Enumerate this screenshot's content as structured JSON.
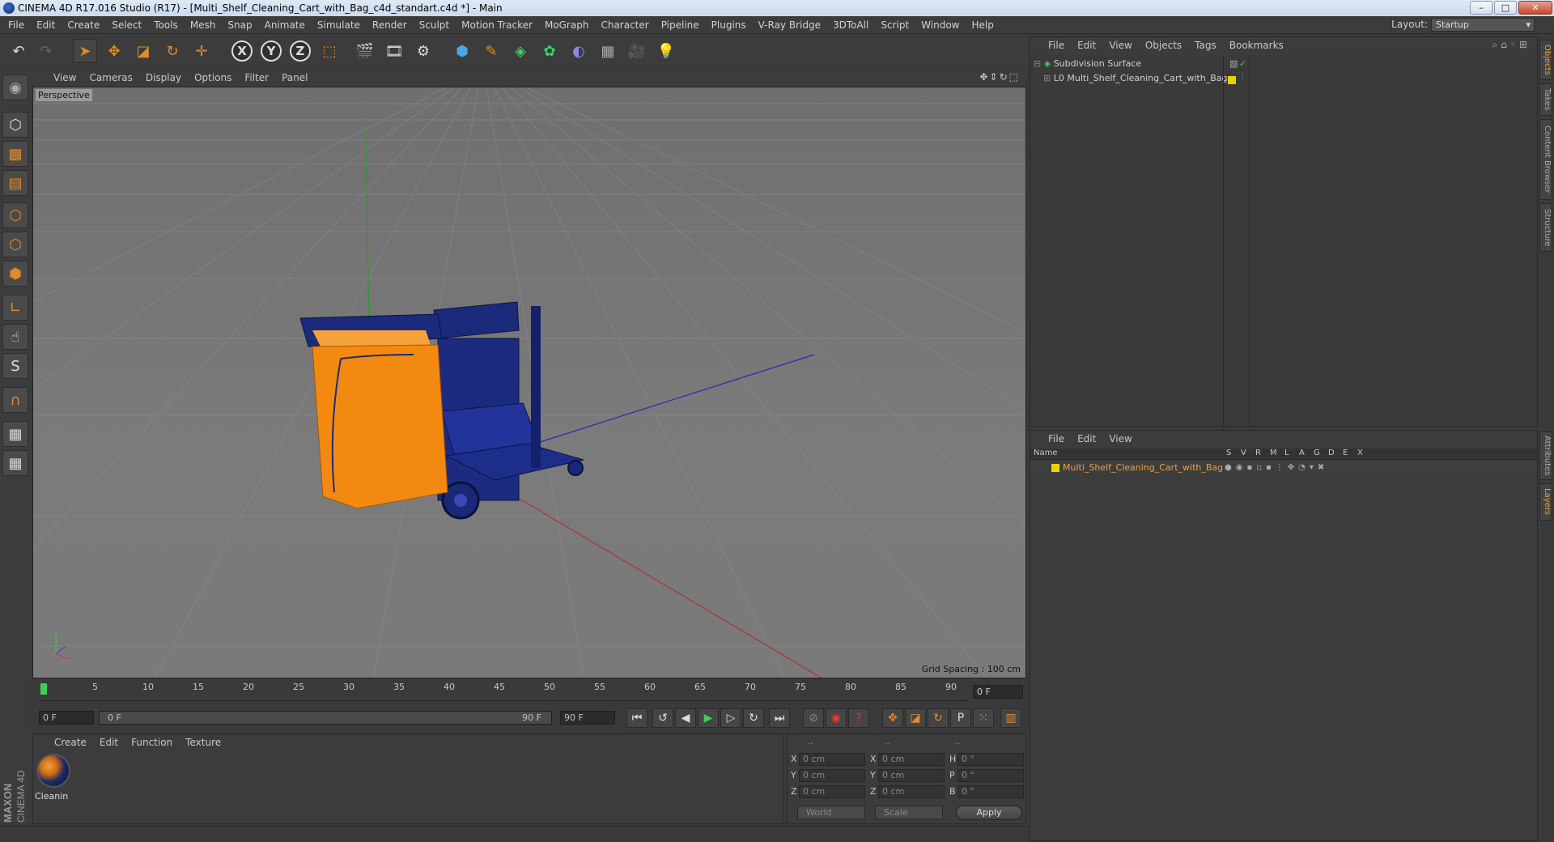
{
  "window": {
    "title": "CINEMA 4D R17.016 Studio (R17) - [Multi_Shelf_Cleaning_Cart_with_Bag_c4d_standart.c4d *] - Main",
    "minimize": "–",
    "maximize": "□",
    "close": "✕"
  },
  "menu": [
    "File",
    "Edit",
    "Create",
    "Select",
    "Tools",
    "Mesh",
    "Snap",
    "Animate",
    "Simulate",
    "Render",
    "Sculpt",
    "Motion Tracker",
    "MoGraph",
    "Character",
    "Pipeline",
    "Plugins",
    "V-Ray Bridge",
    "3DToAll",
    "Script",
    "Window",
    "Help"
  ],
  "layout": {
    "label": "Layout:",
    "value": "Startup"
  },
  "viewport": {
    "menu": [
      "View",
      "Cameras",
      "Display",
      "Options",
      "Filter",
      "Panel"
    ],
    "label": "Perspective",
    "grid_spacing": "Grid Spacing : 100 cm"
  },
  "timeline": {
    "ticks": [
      "0",
      "5",
      "10",
      "15",
      "20",
      "25",
      "30",
      "35",
      "40",
      "45",
      "50",
      "55",
      "60",
      "65",
      "70",
      "75",
      "80",
      "85",
      "90"
    ],
    "current_frame": "0 F",
    "start_frame": "0 F",
    "range_start": "0 F",
    "range_end": "90 F",
    "end_frame": "90 F"
  },
  "material_panel": {
    "menu": [
      "Create",
      "Edit",
      "Function",
      "Texture"
    ],
    "material_name": "Cleanin"
  },
  "coords": {
    "headers": [
      "--",
      "--",
      "--"
    ],
    "rows": [
      {
        "l1": "X",
        "v1": "0 cm",
        "l2": "X",
        "v2": "0 cm",
        "l3": "H",
        "v3": "0 °"
      },
      {
        "l1": "Y",
        "v1": "0 cm",
        "l2": "Y",
        "v2": "0 cm",
        "l3": "P",
        "v3": "0 °"
      },
      {
        "l1": "Z",
        "v1": "0 cm",
        "l2": "Z",
        "v2": "0 cm",
        "l3": "B",
        "v3": "0 °"
      }
    ],
    "mode": "World",
    "scale": "Scale",
    "apply": "Apply"
  },
  "maxon": {
    "brand": "MAXON",
    "product": "CINEMA 4D"
  },
  "objects_panel": {
    "menu": [
      "File",
      "Edit",
      "View",
      "Objects",
      "Tags",
      "Bookmarks"
    ],
    "items": [
      {
        "name": "Subdivision Surface"
      },
      {
        "name": "Multi_Shelf_Cleaning_Cart_with_Bag"
      }
    ]
  },
  "layers_panel": {
    "menu": [
      "File",
      "Edit",
      "View"
    ],
    "columns": [
      "Name",
      "S",
      "V",
      "R",
      "M",
      "L",
      "A",
      "G",
      "D",
      "E",
      "X"
    ],
    "layer_name": "Multi_Shelf_Cleaning_Cart_with_Bag"
  },
  "right_tabs": [
    "Objects",
    "Takes",
    "Content Browser",
    "Structure",
    "Attributes",
    "Layers"
  ],
  "colors": {
    "accent": "#e9a23b",
    "layer_yellow": "#e8d400",
    "cart_blue": "#1b2a7a",
    "bag_orange": "#f28a12"
  }
}
